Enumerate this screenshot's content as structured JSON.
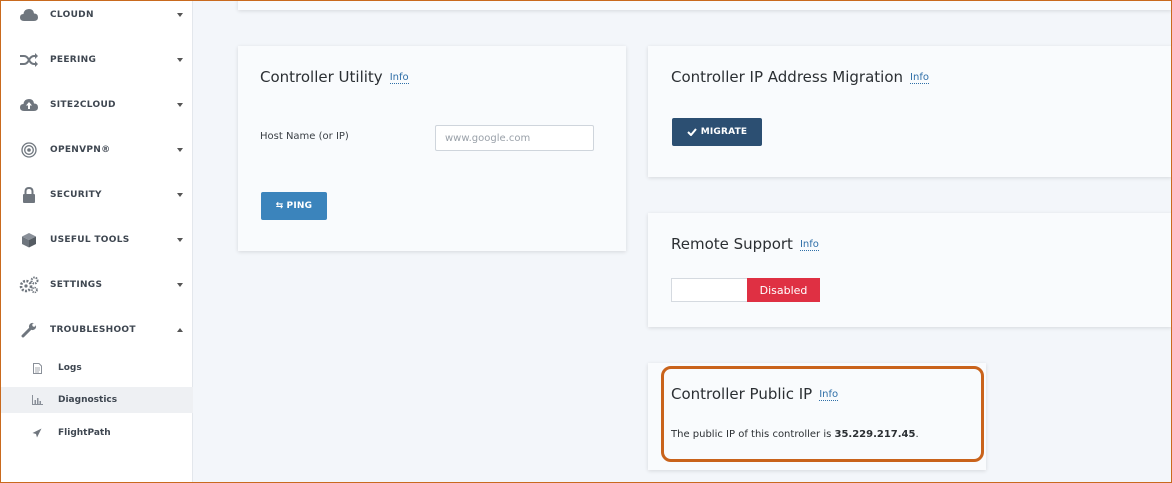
{
  "sidebar": {
    "items": [
      {
        "label": "CLOUDN",
        "icon": "cloud-icon"
      },
      {
        "label": "PEERING",
        "icon": "shuffle-icon"
      },
      {
        "label": "SITE2CLOUD",
        "icon": "cloud-upload-icon"
      },
      {
        "label": "OPENVPN®",
        "icon": "target-icon"
      },
      {
        "label": "SECURITY",
        "icon": "lock-icon"
      },
      {
        "label": "USEFUL TOOLS",
        "icon": "cube-icon"
      },
      {
        "label": "SETTINGS",
        "icon": "gears-icon"
      },
      {
        "label": "TROUBLESHOOT",
        "icon": "wrench-icon"
      }
    ],
    "sub_items": [
      {
        "label": "Logs",
        "icon": "file-icon"
      },
      {
        "label": "Diagnostics",
        "icon": "bar-chart-icon"
      },
      {
        "label": "FlightPath",
        "icon": "plane-icon"
      }
    ]
  },
  "controller_utility": {
    "title": "Controller Utility",
    "info": "Info",
    "host_label": "Host Name (or IP)",
    "host_placeholder": "www.google.com",
    "ping_label": "PING"
  },
  "ip_migration": {
    "title": "Controller IP Address Migration",
    "info": "Info",
    "migrate_label": "MIGRATE"
  },
  "remote_support": {
    "title": "Remote Support",
    "info": "Info",
    "status": "Disabled"
  },
  "public_ip": {
    "title": "Controller Public IP",
    "info": "Info",
    "prefix": "The public IP of this controller is ",
    "ip": "35.229.217.45",
    "suffix": "."
  },
  "colors": {
    "accent": "#3b84bc",
    "migrate": "#2c4f72",
    "disabled": "#df3043",
    "highlight": "#c9631b"
  }
}
